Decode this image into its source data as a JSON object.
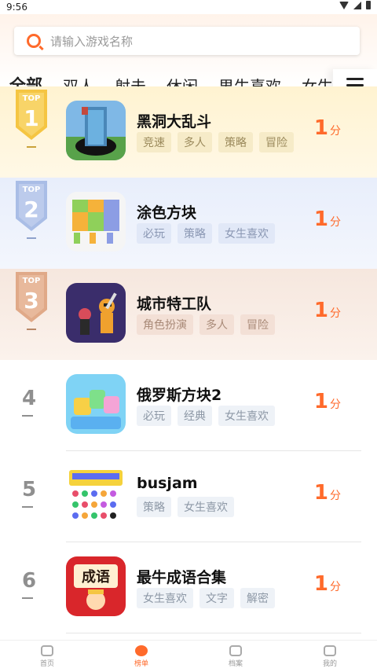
{
  "status": {
    "time": "9:56"
  },
  "search": {
    "placeholder": "请输入游戏名称"
  },
  "tabs": [
    "全部",
    "双人",
    "射击",
    "休闲",
    "男生喜欢",
    "女生"
  ],
  "rank_unit": "分",
  "games": [
    {
      "rank": "1",
      "top_label": "TOP",
      "name": "黑洞大乱斗",
      "tags": [
        "竞速",
        "多人",
        "策略",
        "冒险"
      ],
      "score": "1"
    },
    {
      "rank": "2",
      "top_label": "TOP",
      "name": "涂色方块",
      "tags": [
        "必玩",
        "策略",
        "女生喜欢"
      ],
      "score": "1"
    },
    {
      "rank": "3",
      "top_label": "TOP",
      "name": "城市特工队",
      "tags": [
        "角色扮演",
        "多人",
        "冒险"
      ],
      "score": "1"
    },
    {
      "rank": "4",
      "name": "俄罗斯方块2",
      "tags": [
        "必玩",
        "经典",
        "女生喜欢"
      ],
      "score": "1"
    },
    {
      "rank": "5",
      "name": "busjam",
      "tags": [
        "策略",
        "女生喜欢"
      ],
      "score": "1"
    },
    {
      "rank": "6",
      "name": "最牛成语合集",
      "tags": [
        "女生喜欢",
        "文字",
        "解密"
      ],
      "score": "1"
    }
  ],
  "icon_art": {
    "6": "成语"
  },
  "nav": [
    {
      "label": "首页",
      "icon": "gamepad-icon"
    },
    {
      "label": "榜单",
      "icon": "ranking-icon"
    },
    {
      "label": "档案",
      "icon": "chat-icon"
    },
    {
      "label": "我的",
      "icon": "profile-icon"
    }
  ],
  "colors": {
    "accent": "#ff6a2b",
    "gold": "#f5c542",
    "silver": "#a9bde6",
    "bronze": "#e0a988"
  }
}
